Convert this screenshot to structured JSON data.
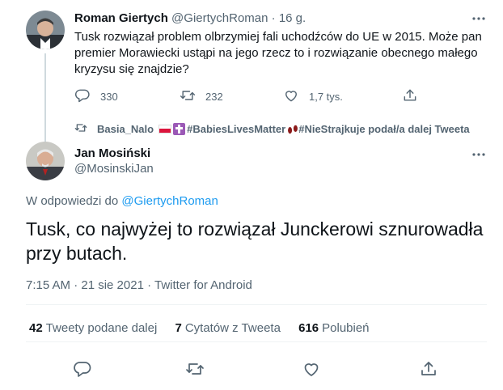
{
  "parent": {
    "name": "Roman Giertych",
    "handle": "@GiertychRoman",
    "dot": "·",
    "time": "16 g.",
    "text": "Tusk rozwiązał problem olbrzymiej fali uchodźców do UE w 2015. Może pan premier Morawiecki ustąpi na jego rzecz to i rozwiązanie obecnego małego kryzysu się znajdzie?",
    "replies": "330",
    "retweets": "232",
    "likes": "1,7 tys."
  },
  "retweeted_by": {
    "user": "Basia_Nalo",
    "hashtag1": "#BabiesLivesMatter",
    "suffix": "#NieStrajkuje podał/a dalej Tweeta"
  },
  "main": {
    "name": "Jan Mosiński",
    "handle": "@MosinskiJan",
    "reply_prefix": "W odpowiedzi do",
    "reply_to": "@GiertychRoman",
    "text": "Tusk, co najwyżej to rozwiązał Junckerowi sznurowadła przy butach.",
    "meta": "7:15 AM · 21 sie 2021 · Twitter for Android",
    "retweets_count": "42",
    "retweets_label": "Tweety podane dalej",
    "quotes_count": "7",
    "quotes_label": "Cytatów z Tweeta",
    "likes_count": "616",
    "likes_label": "Polubień"
  },
  "icons": {
    "reply": "reply-icon",
    "retweet": "retweet-icon",
    "like": "heart-icon",
    "share": "share-icon",
    "more": "more-icon"
  },
  "colors": {
    "text": "#0f1419",
    "secondary": "#536471",
    "link": "#1d9bf0",
    "divider": "#eff3f4"
  }
}
